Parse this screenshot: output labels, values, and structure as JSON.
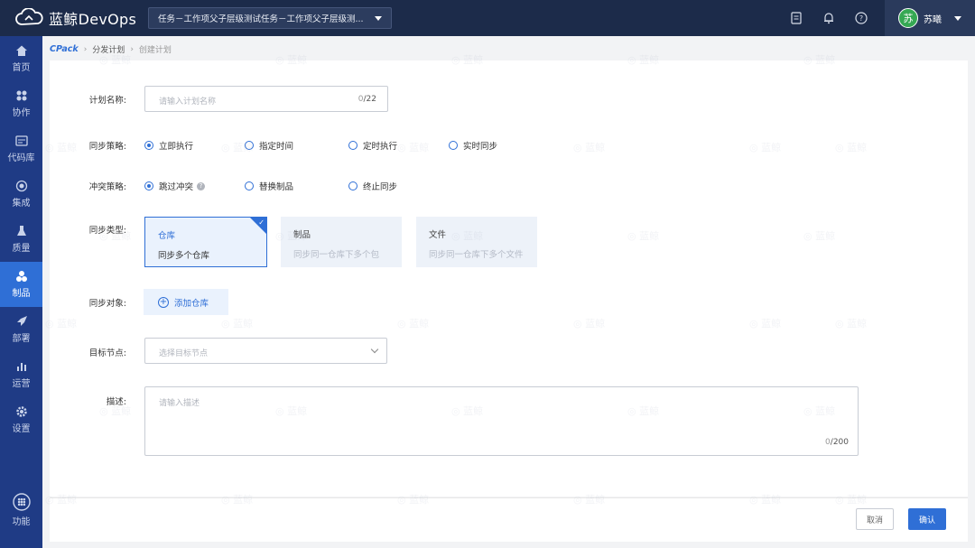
{
  "header": {
    "brand": "蓝鲸DevOps",
    "project": "任务－工作项父子层级测试任务－工作项父子层级测...",
    "user_avatar": "苏",
    "user_name": "苏曦"
  },
  "sidebar": {
    "items": [
      {
        "label": "首页",
        "icon": "home-icon"
      },
      {
        "label": "协作",
        "icon": "collab-icon"
      },
      {
        "label": "代码库",
        "icon": "code-icon"
      },
      {
        "label": "集成",
        "icon": "integration-icon"
      },
      {
        "label": "质量",
        "icon": "quality-icon"
      },
      {
        "label": "制品",
        "icon": "artifact-icon"
      },
      {
        "label": "部署",
        "icon": "deploy-icon"
      },
      {
        "label": "运营",
        "icon": "ops-icon"
      },
      {
        "label": "设置",
        "icon": "settings-icon"
      },
      {
        "label": "功能",
        "icon": "grid-icon"
      }
    ],
    "active": "制品"
  },
  "breadcrumb": {
    "root": "CPack",
    "parent": "分发计划",
    "current": "创建计划"
  },
  "form": {
    "name_label": "计划名称:",
    "name_placeholder": "请输入计划名称",
    "name_count": "0",
    "name_max": "/22",
    "strategy_label": "同步策略:",
    "strategy_options": [
      "立即执行",
      "指定时间",
      "定时执行",
      "实时同步"
    ],
    "conflict_label": "冲突策略:",
    "conflict_options": [
      "跳过冲突",
      "替换制品",
      "终止同步"
    ],
    "type_label": "同步类型:",
    "types": [
      {
        "title": "仓库",
        "desc": "同步多个仓库"
      },
      {
        "title": "制品",
        "desc": "同步同一仓库下多个包"
      },
      {
        "title": "文件",
        "desc": "同步同一仓库下多个文件"
      }
    ],
    "object_label": "同步对象:",
    "add_repo": "添加仓库",
    "node_label": "目标节点:",
    "node_placeholder": "选择目标节点",
    "desc_label": "描述:",
    "desc_placeholder": "请输入描述",
    "desc_count": "0",
    "desc_max": "/200"
  },
  "footer": {
    "cancel": "取消",
    "confirm": "确认"
  },
  "colors": {
    "primary": "#2f6fd6",
    "topbar": "#1c2b4a",
    "sidebar": "#1f3b85"
  }
}
